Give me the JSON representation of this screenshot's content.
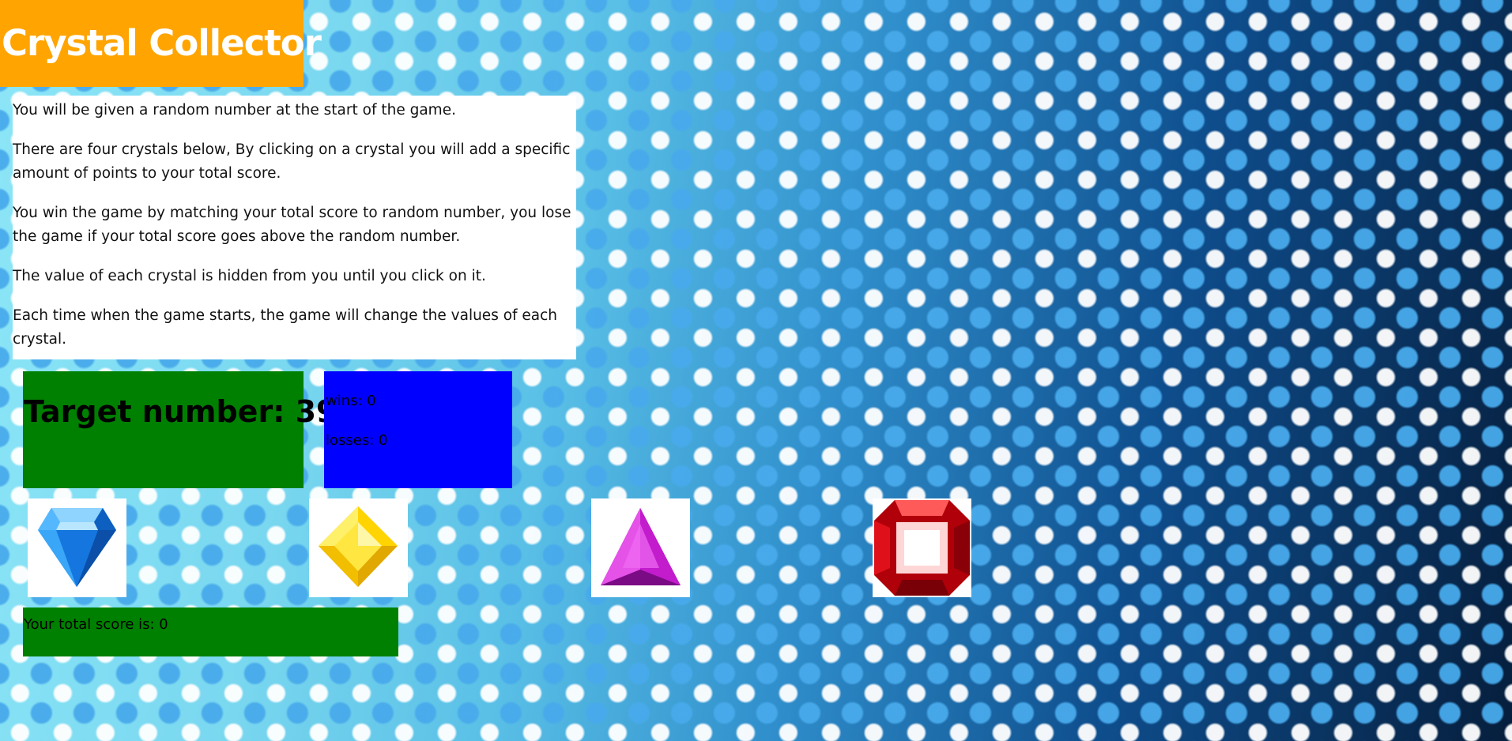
{
  "header": {
    "title": "Crystal Collector"
  },
  "instructions": {
    "paragraphs": [
      "You will be given a random number at the start of the game.",
      "There are four crystals below, By clicking on a crystal you will add a specific amount of points to your total score.",
      "You win the game by matching your total score to random number, you lose the game if your total score goes above the random number.",
      "The value of each crystal is hidden from you until you click on it.",
      "Each time when the game starts, the game will change the values of each crystal."
    ]
  },
  "stats": {
    "target_text": "Target number: 39",
    "target_number": 39,
    "wins_text": "wins: 0",
    "losses_text": "losses: 0",
    "wins": 0,
    "losses": 0
  },
  "crystals": [
    {
      "name": "blue-crystal-icon",
      "color": "#1e8ff0"
    },
    {
      "name": "yellow-crystal-icon",
      "color": "#ffd400"
    },
    {
      "name": "purple-crystal-icon",
      "color": "#d21ed2"
    },
    {
      "name": "red-crystal-icon",
      "color": "#e0101a"
    }
  ],
  "score": {
    "text": "Your total score is: 0",
    "value": 0
  },
  "colors": {
    "title_bg": "#ffa400",
    "target_bg": "#008000",
    "record_bg": "#0000ff",
    "score_bg": "#008000"
  }
}
